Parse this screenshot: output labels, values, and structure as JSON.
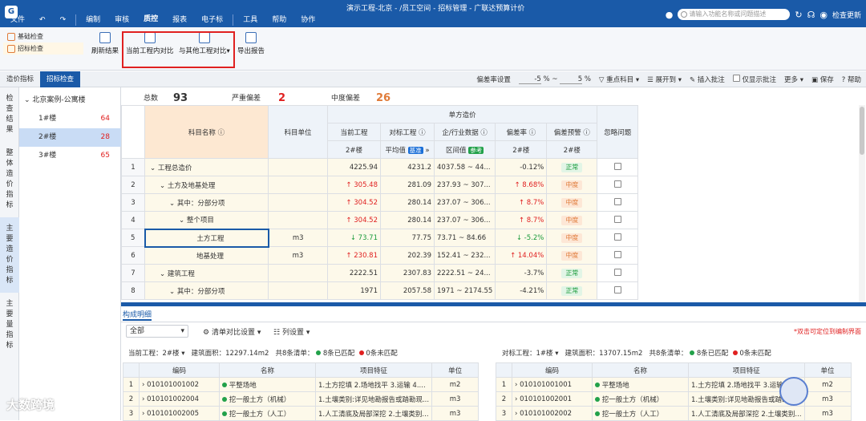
{
  "app": {
    "file_menu": "文件",
    "menu_items": [
      "编制",
      "审核",
      "质控",
      "报表",
      "电子标",
      "工具",
      "帮助",
      "协作"
    ],
    "active_menu": "质控",
    "title": "演示工程-北京 - /员工空间 - 招标管理 - 广联达预算计价",
    "search_placeholder": "请输入功能名称或问题描述",
    "update_label": "检查更新"
  },
  "ribbon": {
    "left_items": [
      "基础检查",
      "招标检查"
    ],
    "refresh": "刷新结果",
    "compare_internal": "当前工程内对比",
    "compare_other": "与其他工程对比",
    "export": "导出报告"
  },
  "tabs": {
    "items": [
      "造价指标",
      "招标检查"
    ],
    "active": "招标检查"
  },
  "toolbar": {
    "deviation_label": "偏差率设置",
    "dev_low": "-5",
    "dev_high": "5",
    "pct": "%",
    "tilde": "~",
    "key_subject": "重点科目",
    "expand_to": "展开到",
    "insert_note": "插入批注",
    "only_notes": "仅显示批注",
    "more": "更多",
    "save": "保存",
    "help": "帮助"
  },
  "vnav": [
    "检查结果",
    "整体造价指标",
    "主要造价指标",
    "主要量指标"
  ],
  "tree": {
    "root": "北京案例-公寓楼",
    "items": [
      {
        "label": "1#楼",
        "count": "64"
      },
      {
        "label": "2#楼",
        "count": "28"
      },
      {
        "label": "3#楼",
        "count": "65"
      }
    ]
  },
  "summary": {
    "total_label": "总数",
    "total": "93",
    "severe_label": "严重偏差",
    "severe": "2",
    "moderate_label": "中度偏差",
    "moderate": "26"
  },
  "grid": {
    "h_name": "科目名称",
    "h_unit": "科目单位",
    "h_unit_cost": "单方造价",
    "h_current": "当前工程",
    "h_target": "对标工程",
    "h_industry": "企/行业数据",
    "h_deviation": "偏差率",
    "h_warning": "偏差预警",
    "h_ignore": "忽略问题",
    "sub_current": "2#楼",
    "sub_target": "平均值",
    "sub_target_badge": "基准",
    "sub_industry": "区间值",
    "sub_industry_badge": "参考",
    "sub_deviation": "2#楼",
    "sub_warning": "2#楼",
    "rows": [
      {
        "i": "1",
        "name": "工程总造价",
        "unit": "",
        "cur": "4225.94",
        "tgt": "4231.2",
        "ind": "4037.58 ~ 44...",
        "dev": "-0.12%",
        "warn": "正常",
        "level": "ok",
        "dir": ""
      },
      {
        "i": "2",
        "name": "土方及地基处理",
        "unit": "",
        "cur": "305.48",
        "tgt": "281.09",
        "ind": "237.93 ~ 307...",
        "dev": "8.68%",
        "warn": "中度",
        "level": "mid",
        "dir": "up"
      },
      {
        "i": "3",
        "name": "其中：分部分项",
        "unit": "",
        "cur": "304.52",
        "tgt": "280.14",
        "ind": "237.07 ~ 306...",
        "dev": "8.7%",
        "warn": "中度",
        "level": "mid",
        "dir": "up"
      },
      {
        "i": "4",
        "name": "整个项目",
        "unit": "",
        "cur": "304.52",
        "tgt": "280.14",
        "ind": "237.07 ~ 306...",
        "dev": "8.7%",
        "warn": "中度",
        "level": "mid",
        "dir": "up"
      },
      {
        "i": "5",
        "name": "土方工程",
        "unit": "m3",
        "cur": "73.71",
        "tgt": "77.75",
        "ind": "73.71 ~ 84.66",
        "dev": "-5.2%",
        "warn": "中度",
        "level": "mid",
        "dir": "dn"
      },
      {
        "i": "6",
        "name": "地基处理",
        "unit": "m3",
        "cur": "230.81",
        "tgt": "202.39",
        "ind": "152.41 ~ 232...",
        "dev": "14.04%",
        "warn": "中度",
        "level": "mid",
        "dir": "up"
      },
      {
        "i": "7",
        "name": "建筑工程",
        "unit": "",
        "cur": "2222.51",
        "tgt": "2307.83",
        "ind": "2222.51 ~ 24...",
        "dev": "-3.7%",
        "warn": "正常",
        "level": "ok",
        "dir": ""
      },
      {
        "i": "8",
        "name": "其中：分部分项",
        "unit": "",
        "cur": "1971",
        "tgt": "2057.58",
        "ind": "1971 ~ 2174.55",
        "dev": "-4.21%",
        "warn": "正常",
        "level": "ok",
        "dir": ""
      }
    ]
  },
  "bottom": {
    "tab": "构成明细",
    "filter": "全部",
    "compare_settings": "清单对比设置",
    "column_settings": "列设置",
    "hint": "*双击可定位到编制界面",
    "left": {
      "project_label": "当前工程：",
      "project": "2#楼",
      "area_label": "建筑面积：",
      "area": "12297.14m2",
      "count": "共8条清单：",
      "matched": "8条已匹配",
      "unmatched": "0条未匹配"
    },
    "right": {
      "project_label": "对标工程：",
      "project": "1#楼",
      "area_label": "建筑面积：",
      "area": "13707.15m2",
      "count": "共8条清单：",
      "matched": "8条已匹配",
      "unmatched": "0条未匹配"
    },
    "cols": [
      "编码",
      "名称",
      "项目特征",
      "单位"
    ],
    "left_rows": [
      {
        "i": "1",
        "code": "010101001002",
        "name": "平整场地",
        "feat": "1.土方挖填 2.场地找平 3.运输 4....",
        "unit": "m2"
      },
      {
        "i": "2",
        "code": "010101002004",
        "name": "挖一般土方（机械）",
        "feat": "1.土壤类别:详见地勘报告或踏勘现...",
        "unit": "m3"
      },
      {
        "i": "3",
        "code": "010101002005",
        "name": "挖一般土方（人工）",
        "feat": "1.人工清底及局部深挖 2.土壤类别...",
        "unit": "m3"
      }
    ],
    "right_rows": [
      {
        "i": "1",
        "code": "010101001001",
        "name": "平整场地",
        "feat": "1.土方挖填 2.场地找平 3.运输 4....",
        "unit": "m2"
      },
      {
        "i": "2",
        "code": "010101002001",
        "name": "挖一般土方（机械）",
        "feat": "1.土壤类别:详见地勘报告或踏勘...",
        "unit": "m3"
      },
      {
        "i": "3",
        "code": "010101002002",
        "name": "挖一般土方（人工）",
        "feat": "1.人工清底及局部深挖 2.土壤类别...",
        "unit": "m3"
      }
    ]
  },
  "watermark": "大数跨境"
}
